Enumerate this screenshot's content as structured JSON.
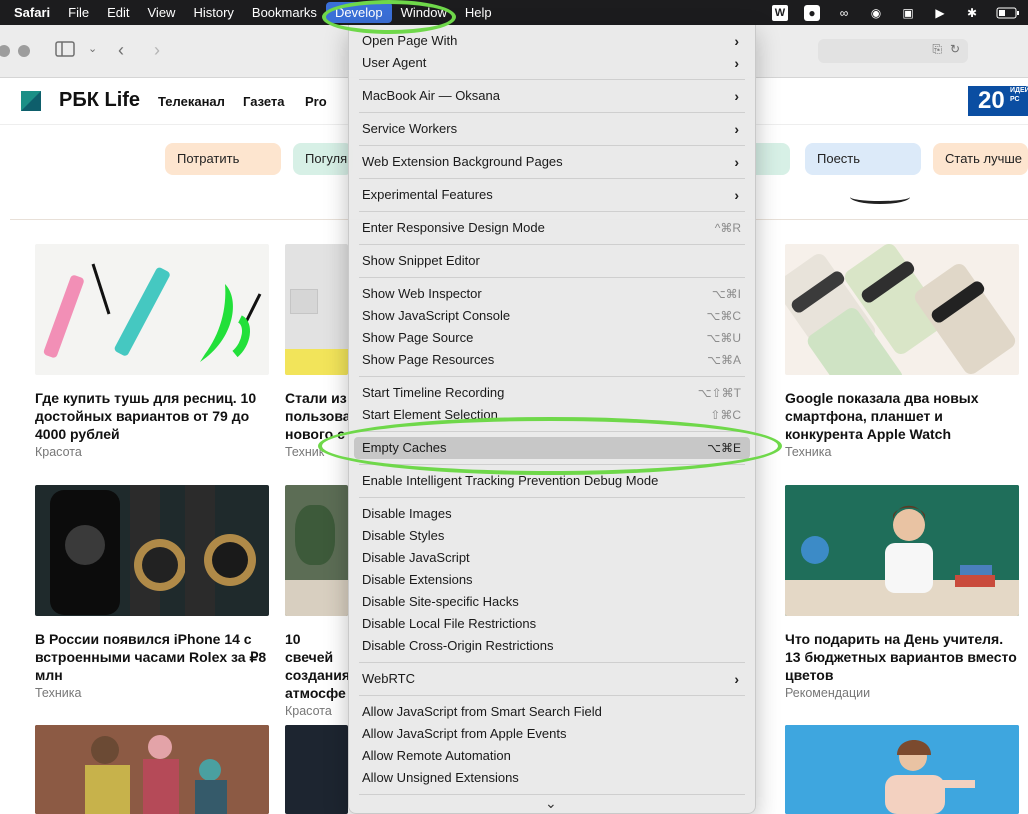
{
  "menubar": {
    "apple": "Safari",
    "items": [
      "File",
      "Edit",
      "View",
      "History",
      "Bookmarks",
      "Develop",
      "Window",
      "Help"
    ],
    "active": "Develop"
  },
  "site": {
    "logo": "РБК Life",
    "nav": [
      "Телеканал",
      "Газета",
      "Pro"
    ],
    "badge": "20",
    "badge_small": "ИДЕЙ РС"
  },
  "pills": [
    "Потратить",
    "Погуля",
    "Поесть",
    "Стать лучше"
  ],
  "cards": [
    {
      "title": "Где купить тушь для ресниц. 10 достойных вариантов от 79 до 4000 рублей",
      "category": "Красота"
    },
    {
      "title": "Стали из пользова нового с",
      "category": "Техник"
    },
    {
      "title": "Google показала два новых смартфона, планшет и конкурента Apple Watch",
      "category": "Техника"
    },
    {
      "title": "В России появился iPhone 14 с встроенными часами Rolex за ₽8 млн",
      "category": "Техника"
    },
    {
      "title": "10 свечей создания атмосфе",
      "category": "Красота"
    },
    {
      "title": "Что подарить на День учителя. 13 бюджетных вариантов вместо цветов",
      "category": "Рекомендации"
    }
  ],
  "menu": {
    "items": [
      {
        "label": "Open Page With",
        "arrow": "›"
      },
      {
        "label": "User Agent",
        "arrow": "›"
      },
      {
        "label": "MacBook Air — Oksana",
        "arrow": "›"
      },
      {
        "label": "Service Workers",
        "arrow": "›"
      },
      {
        "label": "Web Extension Background Pages",
        "arrow": "›"
      },
      {
        "label": "Experimental Features",
        "arrow": "›"
      },
      {
        "label": "Enter Responsive Design Mode",
        "shortcut": "^⌘R"
      },
      {
        "label": "Show Snippet Editor"
      },
      {
        "label": "Show Web Inspector",
        "shortcut": "⌥⌘I"
      },
      {
        "label": "Show JavaScript Console",
        "shortcut": "⌥⌘C"
      },
      {
        "label": "Show Page Source",
        "shortcut": "⌥⌘U"
      },
      {
        "label": "Show Page Resources",
        "shortcut": "⌥⌘A"
      },
      {
        "label": "Start Timeline Recording",
        "shortcut": "⌥⇧⌘T"
      },
      {
        "label": "Start Element Selection",
        "shortcut": "⇧⌘C"
      },
      {
        "label": "Empty Caches",
        "shortcut": "⌥⌘E"
      },
      {
        "label": "Enable Intelligent Tracking Prevention Debug Mode"
      },
      {
        "label": "Disable Images"
      },
      {
        "label": "Disable Styles"
      },
      {
        "label": "Disable JavaScript"
      },
      {
        "label": "Disable Extensions"
      },
      {
        "label": "Disable Site-specific Hacks"
      },
      {
        "label": "Disable Local File Restrictions"
      },
      {
        "label": "Disable Cross-Origin Restrictions"
      },
      {
        "label": "WebRTC",
        "arrow": "›"
      },
      {
        "label": "Allow JavaScript from Smart Search Field"
      },
      {
        "label": "Allow JavaScript from Apple Events"
      },
      {
        "label": "Allow Remote Automation"
      },
      {
        "label": "Allow Unsigned Extensions"
      }
    ],
    "more": "⌄"
  },
  "colors": {
    "menubar": "#1c1c1e",
    "highlight_ring": "#6fd84a",
    "selected_item": "#c7c7c7",
    "badge": "#0b4ea2"
  }
}
